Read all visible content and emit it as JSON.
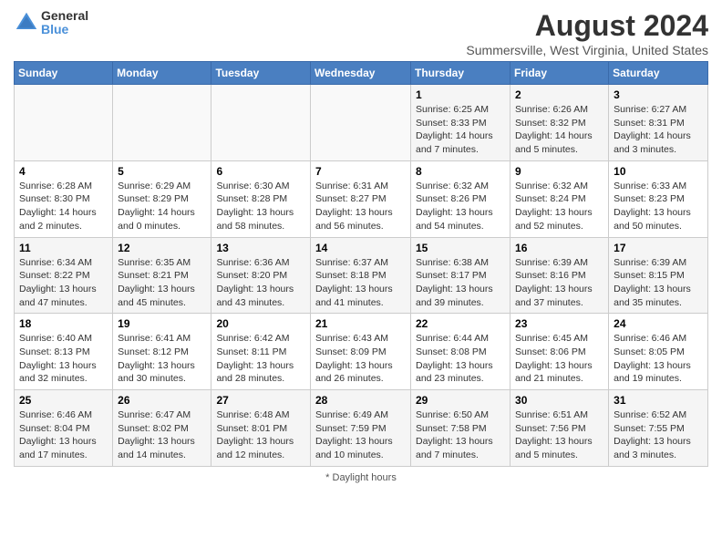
{
  "header": {
    "logo_line1": "General",
    "logo_line2": "Blue",
    "main_title": "August 2024",
    "subtitle": "Summersville, West Virginia, United States"
  },
  "days_of_week": [
    "Sunday",
    "Monday",
    "Tuesday",
    "Wednesday",
    "Thursday",
    "Friday",
    "Saturday"
  ],
  "weeks": [
    [
      {
        "day": "",
        "info": ""
      },
      {
        "day": "",
        "info": ""
      },
      {
        "day": "",
        "info": ""
      },
      {
        "day": "",
        "info": ""
      },
      {
        "day": "1",
        "info": "Sunrise: 6:25 AM\nSunset: 8:33 PM\nDaylight: 14 hours and 7 minutes."
      },
      {
        "day": "2",
        "info": "Sunrise: 6:26 AM\nSunset: 8:32 PM\nDaylight: 14 hours and 5 minutes."
      },
      {
        "day": "3",
        "info": "Sunrise: 6:27 AM\nSunset: 8:31 PM\nDaylight: 14 hours and 3 minutes."
      }
    ],
    [
      {
        "day": "4",
        "info": "Sunrise: 6:28 AM\nSunset: 8:30 PM\nDaylight: 14 hours and 2 minutes."
      },
      {
        "day": "5",
        "info": "Sunrise: 6:29 AM\nSunset: 8:29 PM\nDaylight: 14 hours and 0 minutes."
      },
      {
        "day": "6",
        "info": "Sunrise: 6:30 AM\nSunset: 8:28 PM\nDaylight: 13 hours and 58 minutes."
      },
      {
        "day": "7",
        "info": "Sunrise: 6:31 AM\nSunset: 8:27 PM\nDaylight: 13 hours and 56 minutes."
      },
      {
        "day": "8",
        "info": "Sunrise: 6:32 AM\nSunset: 8:26 PM\nDaylight: 13 hours and 54 minutes."
      },
      {
        "day": "9",
        "info": "Sunrise: 6:32 AM\nSunset: 8:24 PM\nDaylight: 13 hours and 52 minutes."
      },
      {
        "day": "10",
        "info": "Sunrise: 6:33 AM\nSunset: 8:23 PM\nDaylight: 13 hours and 50 minutes."
      }
    ],
    [
      {
        "day": "11",
        "info": "Sunrise: 6:34 AM\nSunset: 8:22 PM\nDaylight: 13 hours and 47 minutes."
      },
      {
        "day": "12",
        "info": "Sunrise: 6:35 AM\nSunset: 8:21 PM\nDaylight: 13 hours and 45 minutes."
      },
      {
        "day": "13",
        "info": "Sunrise: 6:36 AM\nSunset: 8:20 PM\nDaylight: 13 hours and 43 minutes."
      },
      {
        "day": "14",
        "info": "Sunrise: 6:37 AM\nSunset: 8:18 PM\nDaylight: 13 hours and 41 minutes."
      },
      {
        "day": "15",
        "info": "Sunrise: 6:38 AM\nSunset: 8:17 PM\nDaylight: 13 hours and 39 minutes."
      },
      {
        "day": "16",
        "info": "Sunrise: 6:39 AM\nSunset: 8:16 PM\nDaylight: 13 hours and 37 minutes."
      },
      {
        "day": "17",
        "info": "Sunrise: 6:39 AM\nSunset: 8:15 PM\nDaylight: 13 hours and 35 minutes."
      }
    ],
    [
      {
        "day": "18",
        "info": "Sunrise: 6:40 AM\nSunset: 8:13 PM\nDaylight: 13 hours and 32 minutes."
      },
      {
        "day": "19",
        "info": "Sunrise: 6:41 AM\nSunset: 8:12 PM\nDaylight: 13 hours and 30 minutes."
      },
      {
        "day": "20",
        "info": "Sunrise: 6:42 AM\nSunset: 8:11 PM\nDaylight: 13 hours and 28 minutes."
      },
      {
        "day": "21",
        "info": "Sunrise: 6:43 AM\nSunset: 8:09 PM\nDaylight: 13 hours and 26 minutes."
      },
      {
        "day": "22",
        "info": "Sunrise: 6:44 AM\nSunset: 8:08 PM\nDaylight: 13 hours and 23 minutes."
      },
      {
        "day": "23",
        "info": "Sunrise: 6:45 AM\nSunset: 8:06 PM\nDaylight: 13 hours and 21 minutes."
      },
      {
        "day": "24",
        "info": "Sunrise: 6:46 AM\nSunset: 8:05 PM\nDaylight: 13 hours and 19 minutes."
      }
    ],
    [
      {
        "day": "25",
        "info": "Sunrise: 6:46 AM\nSunset: 8:04 PM\nDaylight: 13 hours and 17 minutes."
      },
      {
        "day": "26",
        "info": "Sunrise: 6:47 AM\nSunset: 8:02 PM\nDaylight: 13 hours and 14 minutes."
      },
      {
        "day": "27",
        "info": "Sunrise: 6:48 AM\nSunset: 8:01 PM\nDaylight: 13 hours and 12 minutes."
      },
      {
        "day": "28",
        "info": "Sunrise: 6:49 AM\nSunset: 7:59 PM\nDaylight: 13 hours and 10 minutes."
      },
      {
        "day": "29",
        "info": "Sunrise: 6:50 AM\nSunset: 7:58 PM\nDaylight: 13 hours and 7 minutes."
      },
      {
        "day": "30",
        "info": "Sunrise: 6:51 AM\nSunset: 7:56 PM\nDaylight: 13 hours and 5 minutes."
      },
      {
        "day": "31",
        "info": "Sunrise: 6:52 AM\nSunset: 7:55 PM\nDaylight: 13 hours and 3 minutes."
      }
    ]
  ],
  "footer": {
    "note": "Daylight hours"
  }
}
